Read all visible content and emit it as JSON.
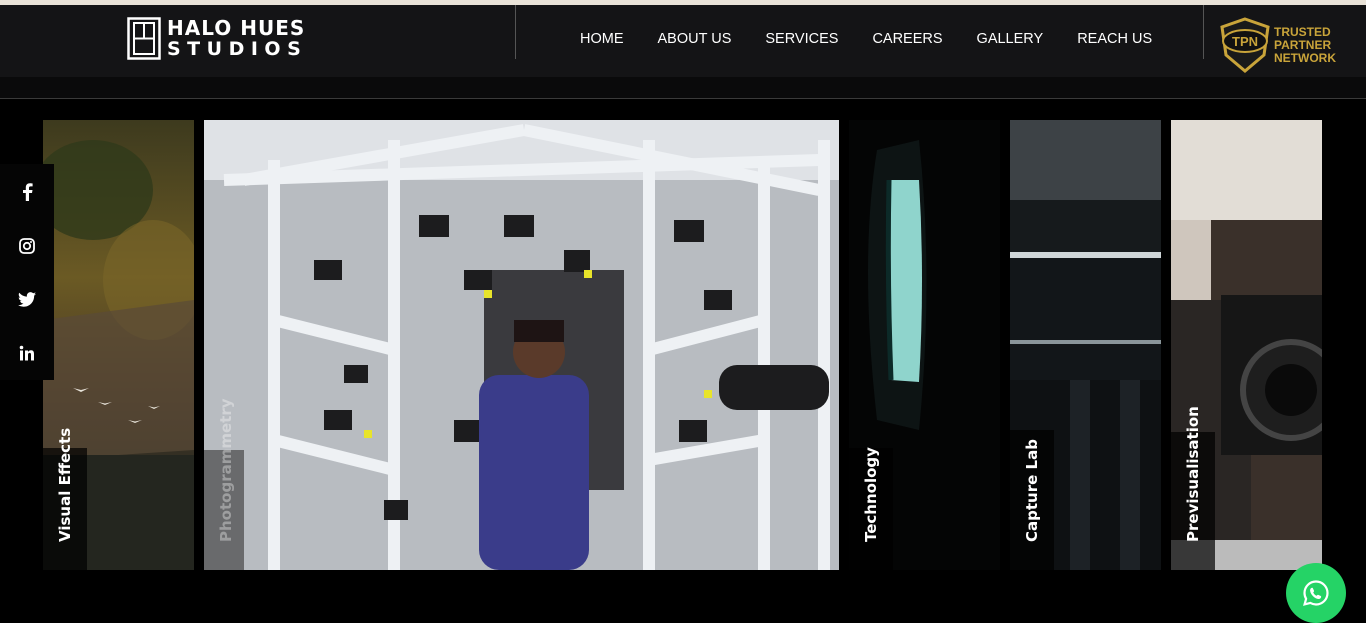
{
  "brand": {
    "line1": "HALO HUES",
    "line2": "STUDIOS"
  },
  "nav": {
    "items": [
      "HOME",
      "ABOUT US",
      "SERVICES",
      "CAREERS",
      "GALLERY",
      "REACH US"
    ]
  },
  "badge": {
    "monogram": "TPN",
    "line1": "TRUSTED",
    "line2": "PARTNER",
    "line3": "NETWORK",
    "color": "#c9a43a"
  },
  "social": {
    "icons": [
      "facebook-icon",
      "instagram-icon",
      "twitter-icon",
      "linkedin-icon"
    ]
  },
  "gallery": {
    "panels": [
      {
        "label": "Visual Effects"
      },
      {
        "label": "Photogrammetry"
      },
      {
        "label": "Technology"
      },
      {
        "label": "Capture Lab"
      },
      {
        "label": "Previsualisation"
      }
    ]
  },
  "colors": {
    "header_bg": "#141416",
    "accent_green": "#25d366",
    "gold": "#c9a43a"
  }
}
